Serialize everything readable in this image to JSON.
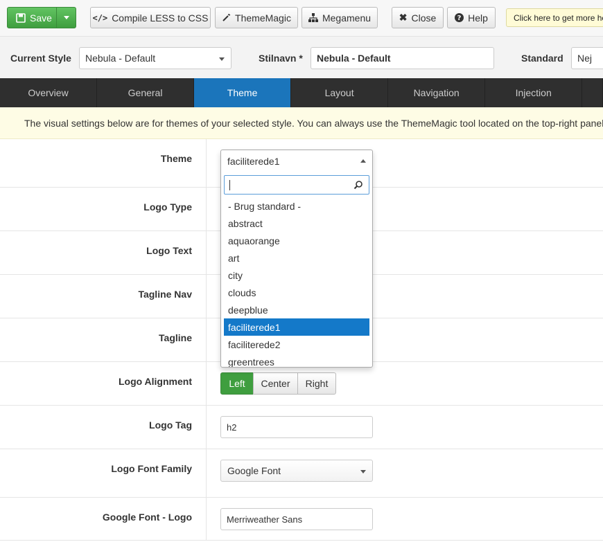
{
  "toolbar": {
    "save": "Save",
    "compile": "Compile LESS to CSS",
    "thememagic": "ThemeMagic",
    "megamenu": "Megamenu",
    "close": "Close",
    "help": "Help",
    "tip": "Click here to get more he"
  },
  "stylebar": {
    "current_style_label": "Current Style",
    "current_style_value": "Nebula - Default",
    "stilnavn_label": "Stilnavn *",
    "stilnavn_value": "Nebula - Default",
    "standard_label": "Standard",
    "standard_value": "Nej"
  },
  "tabs": [
    "Overview",
    "General",
    "Theme",
    "Layout",
    "Navigation",
    "Injection"
  ],
  "active_tab": "Theme",
  "notice": "The visual settings below are for themes of your selected style. You can always use the ThemeMagic tool located on the top-right panel",
  "form": {
    "theme_label": "Theme",
    "theme_value": "faciliterede1",
    "logo_type_label": "Logo Type",
    "logo_text_label": "Logo Text",
    "tagline_nav_label": "Tagline Nav",
    "tagline_label": "Tagline",
    "logo_alignment_label": "Logo Alignment",
    "alignment_options": [
      "Left",
      "Center",
      "Right"
    ],
    "alignment_selected": "Left",
    "logo_tag_label": "Logo Tag",
    "logo_tag_value": "h2",
    "logo_font_family_label": "Logo Font Family",
    "logo_font_family_value": "Google Font",
    "google_font_logo_label": "Google Font - Logo",
    "google_font_logo_value": "Merriweather Sans"
  },
  "dropdown": {
    "search_value": "",
    "items": [
      "- Brug standard -",
      "abstract",
      "aquaorange",
      "art",
      "city",
      "clouds",
      "deepblue",
      "faciliterede1",
      "faciliterede2",
      "greentrees"
    ],
    "highlighted": "faciliterede1"
  },
  "colors": {
    "save_green": "#3f9e3f",
    "tab_active": "#1b75bb",
    "tab_bar": "#2f2f2f",
    "highlight": "#1479c9",
    "notice_bg": "#fefce5"
  }
}
